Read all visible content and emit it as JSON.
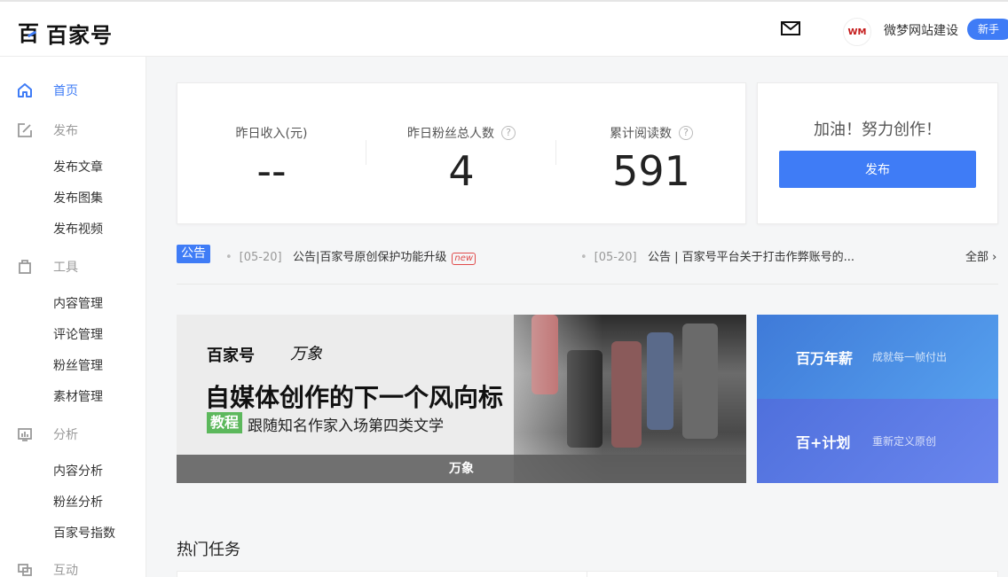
{
  "header": {
    "logo_text": "百家号",
    "user_name": "微梦网站建设",
    "avatar_text": "WM",
    "newbie_label": "新手"
  },
  "sidebar": {
    "home": "首页",
    "publish": "发布",
    "publish_items": [
      "发布文章",
      "发布图集",
      "发布视频"
    ],
    "tools": "工具",
    "tools_items": [
      "内容管理",
      "评论管理",
      "粉丝管理",
      "素材管理"
    ],
    "analysis": "分析",
    "analysis_items": [
      "内容分析",
      "粉丝分析",
      "百家号指数"
    ],
    "interact": "互动"
  },
  "stats": {
    "income_label": "昨日收入(元)",
    "income_value": "--",
    "fans_label": "昨日粉丝总人数",
    "fans_value": "4",
    "reads_label": "累计阅读数",
    "reads_value": "591",
    "help_glyph": "?"
  },
  "cta": {
    "cheer": "加油！努力创作！",
    "publish_button": "发布"
  },
  "notices": {
    "tag": "公告",
    "items": [
      {
        "date": "[05-20]",
        "text": "公告|百家号原创保护功能升级",
        "badge": "new"
      },
      {
        "date": "[05-20]",
        "text": "公告 | 百家号平台关于打击作弊账号的..."
      }
    ],
    "all_link": "全部"
  },
  "banner": {
    "brand": "百家号",
    "sub_brand": "万象",
    "headline": "自媒体创作的下一个风向标",
    "tag": "教程",
    "tagline": "跟随知名作家入场第四类文学",
    "footer": "万象"
  },
  "promos": [
    {
      "title": "百万年薪",
      "desc": "成就每一帧付出",
      "color": "#4a8ae6"
    },
    {
      "title": "百+计划",
      "desc": "重新定义原创",
      "color": "#5a7de8"
    }
  ],
  "section": {
    "hot_tasks": "热门任务"
  },
  "colors": {
    "accent": "#3f7cf6",
    "tag_green": "#5cb85c"
  }
}
